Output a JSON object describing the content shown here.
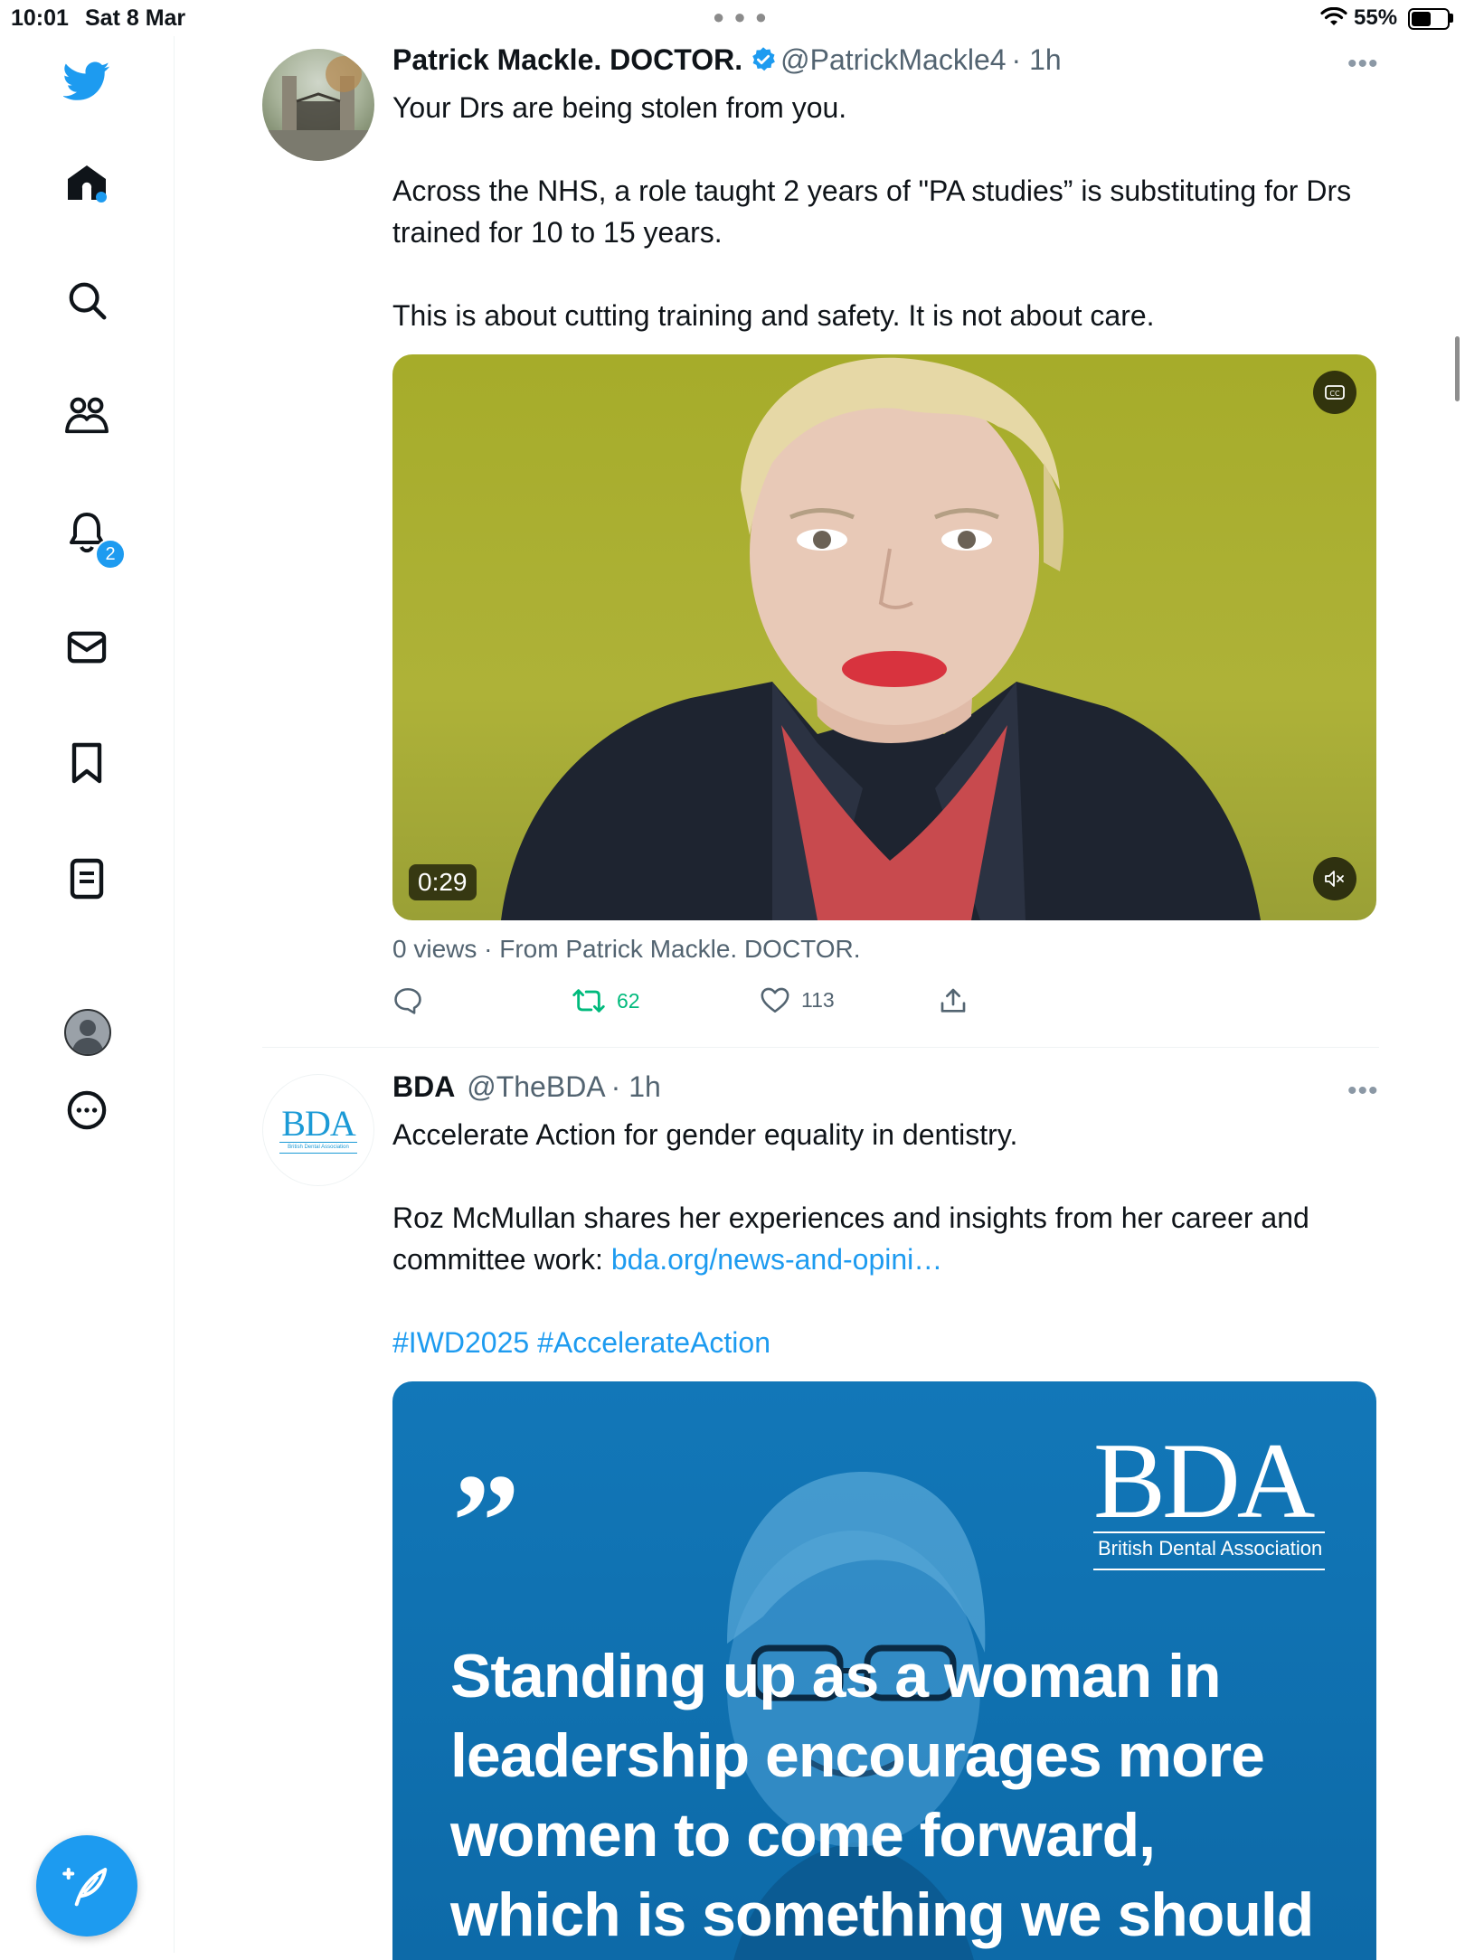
{
  "status_bar": {
    "time": "10:01",
    "date": "Sat 8 Mar",
    "battery": "55%",
    "battery_level": 0.55
  },
  "sidebar": {
    "items": [
      {
        "name": "twitter-logo"
      },
      {
        "name": "home"
      },
      {
        "name": "search"
      },
      {
        "name": "communities"
      },
      {
        "name": "notifications",
        "badge": "2"
      },
      {
        "name": "messages"
      },
      {
        "name": "bookmarks"
      },
      {
        "name": "lists"
      },
      {
        "name": "profile"
      },
      {
        "name": "more"
      }
    ]
  },
  "tweets": [
    {
      "display_name": "Patrick Mackle. DOCTOR.",
      "handle": "@PatrickMackle4",
      "time": "· 1h",
      "more": "•••",
      "text": [
        "Your Drs are being stolen from you.",
        "Across the NHS, a role taught 2 years of  \"PA studies”  is substituting for Drs trained for 10 to 15 years.",
        "This is about cutting training and safety.  It is not about care."
      ],
      "video": {
        "duration": "0:29"
      },
      "meta": "0 views · From Patrick Mackle. DOCTOR.",
      "retweets": "62",
      "likes": "113"
    },
    {
      "display_name": "BDA",
      "handle": "@TheBDA",
      "time": "· 1h",
      "more": "•••",
      "avatar_text": "BDA",
      "avatar_subtext": "British Dental Association",
      "text": [
        "Accelerate Action for gender equality in dentistry.",
        "Roz McMullan shares her experiences and insights from her career and committee work: ",
        "#IWD2025 #AccelerateAction"
      ],
      "link": "bda.org/news-and-opini…",
      "image": {
        "quote_mark": "”",
        "logo": "BDA",
        "logo_sub": "British Dental Association",
        "quote": "Standing up as a woman in leadership encourages more women to come forward, which is something we should be proud of."
      }
    }
  ],
  "colors": {
    "accent": "#1d9bf0",
    "retweet": "#00ba7c",
    "text": "#0f1419",
    "secondary": "#536471",
    "bda_blue": "#0d6aa8"
  }
}
